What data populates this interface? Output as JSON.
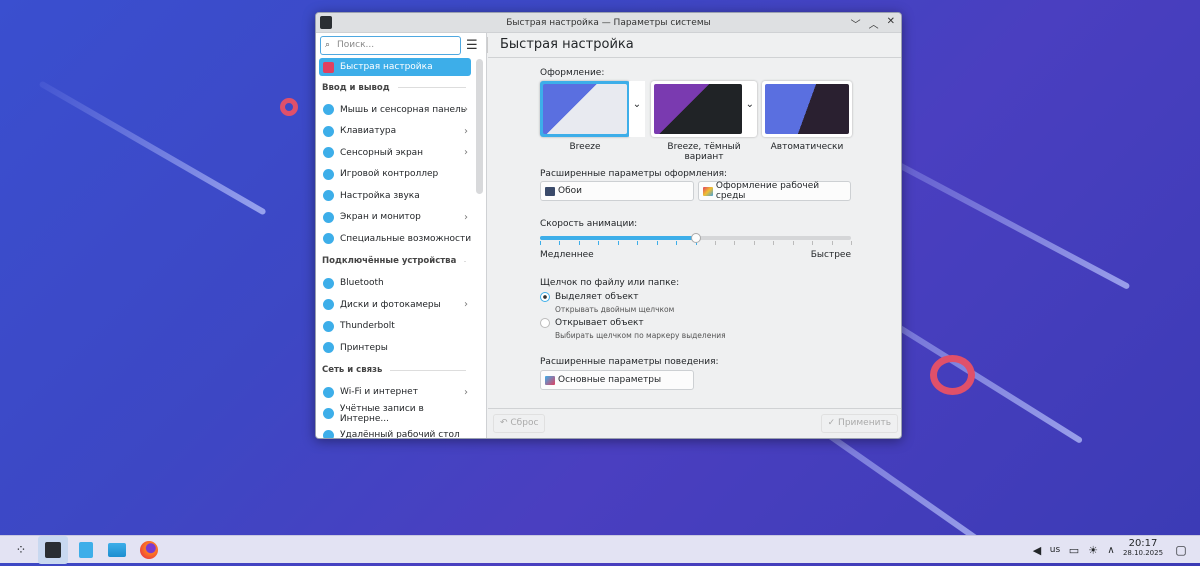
{
  "window": {
    "title": "Быстрая настройка — Параметры системы",
    "controls": [
      "﹀",
      "︿",
      "✕"
    ]
  },
  "sidebar": {
    "search_placeholder": "Поиск...",
    "selected": "Быстрая настройка",
    "groups": [
      {
        "title": "Ввод и вывод",
        "items": [
          {
            "label": "Мышь и сенсорная панель",
            "chevron": true
          },
          {
            "label": "Клавиатура",
            "chevron": true
          },
          {
            "label": "Сенсорный экран",
            "chevron": true
          },
          {
            "label": "Игровой контроллер"
          },
          {
            "label": "Настройка звука"
          },
          {
            "label": "Экран и монитор",
            "chevron": true
          },
          {
            "label": "Специальные возможности"
          }
        ]
      },
      {
        "title": "Подключённые устройства",
        "items": [
          {
            "label": "Bluetooth"
          },
          {
            "label": "Диски и фотокамеры",
            "chevron": true
          },
          {
            "label": "Thunderbolt"
          },
          {
            "label": "Принтеры"
          }
        ]
      },
      {
        "title": "Сеть и связь",
        "items": [
          {
            "label": "Wi-Fi и интернет",
            "chevron": true
          },
          {
            "label": "Учётные записи в Интерне..."
          },
          {
            "label": "Удалённый рабочий стол"
          }
        ]
      }
    ]
  },
  "page": {
    "title": "Быстрая настройка",
    "appearance_label": "Оформление:",
    "themes": [
      {
        "name": "Breeze",
        "selected": true
      },
      {
        "name": "Breeze, тёмный вариант"
      },
      {
        "name": "Автоматически"
      }
    ],
    "advanced_appearance_label": "Расширенные параметры оформления:",
    "wallpaper_button": "Обои",
    "workspace_theme_button": "Оформление рабочей среды",
    "animation_label": "Скорость анимации:",
    "animation_value": 0.5,
    "slower": "Медленнее",
    "faster": "Быстрее",
    "click_label": "Щелчок по файлу или папке:",
    "option1": "Выделяет объект",
    "option1_hint": "Открывать двойным щелчком",
    "option1_checked": true,
    "option2": "Открывает объект",
    "option2_hint": "Выбирать щелчком по маркеру выделения",
    "advanced_behavior_label": "Расширенные параметры поведения:",
    "general_button": "Основные параметры",
    "reset": "↶ Сброс",
    "apply": "✓ Применить"
  },
  "taskbar": {
    "layout": "us",
    "time": "20:17",
    "date": "28.10.2025"
  },
  "colors": {
    "accent": "#3daee9"
  }
}
